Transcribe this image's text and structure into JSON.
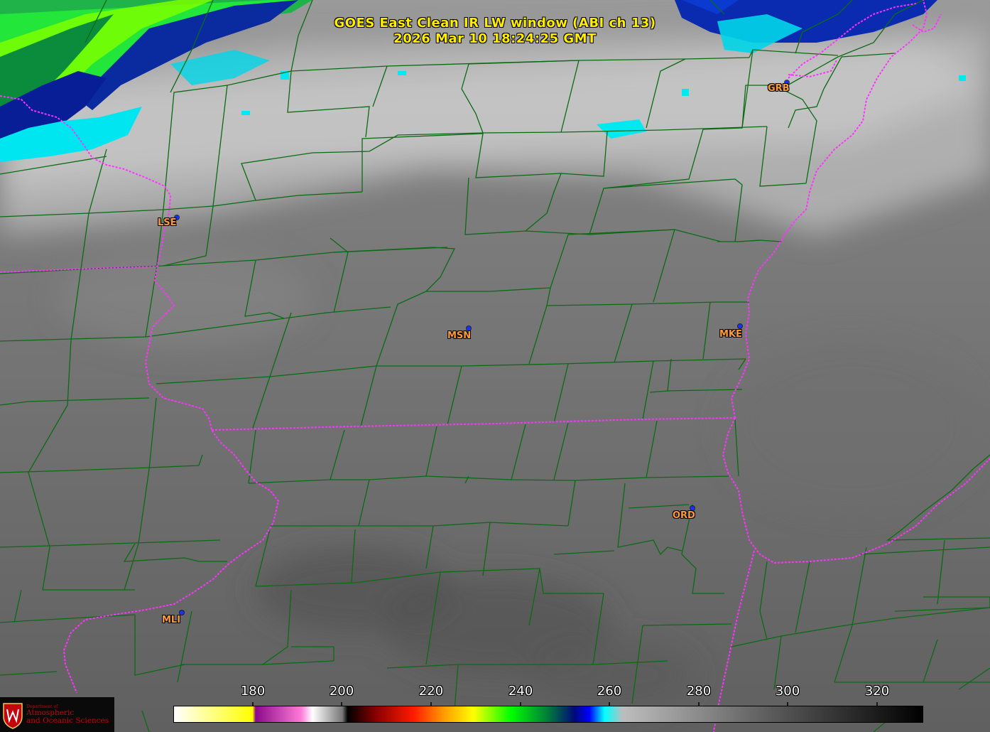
{
  "title": {
    "line1": "GOES East Clean IR LW window (ABI ch 13)",
    "line2": "2026 Mar 10  18:24:25 GMT"
  },
  "stations": [
    {
      "code": "LSE"
    },
    {
      "code": "MSN"
    },
    {
      "code": "MKE"
    },
    {
      "code": "GRB"
    },
    {
      "code": "ORD"
    },
    {
      "code": "MLI"
    }
  ],
  "colorbar": {
    "ticks": [
      "180",
      "200",
      "220",
      "240",
      "260",
      "280",
      "300",
      "320"
    ],
    "range": [
      163,
      330
    ]
  },
  "logo": {
    "dept": "Department of",
    "line1": "Atmospheric",
    "line2": "and Oceanic Sciences"
  },
  "colors": {
    "county_lines": "#0b6b14",
    "state_lines": "#ff33ff",
    "title_text": "#ffee00",
    "station_label": "#ff9a3a",
    "station_dot": "#1530ff"
  }
}
